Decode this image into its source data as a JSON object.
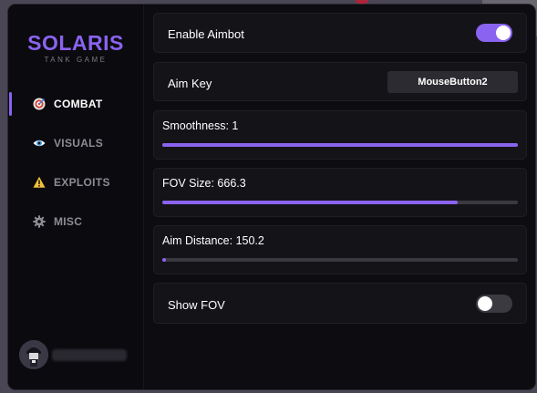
{
  "app": {
    "title": "SOLARIS",
    "subtitle": "TANK GAME",
    "accent": "#8a63f0"
  },
  "sidebar": {
    "items": [
      {
        "label": "COMBAT",
        "icon": "target-icon",
        "active": true
      },
      {
        "label": "VISUALS",
        "icon": "eye-icon",
        "active": false
      },
      {
        "label": "EXPLOITS",
        "icon": "warning-icon",
        "active": false
      },
      {
        "label": "MISC",
        "icon": "gear-icon",
        "active": false
      }
    ]
  },
  "settings": {
    "aimbot": {
      "label": "Enable Aimbot",
      "enabled": true
    },
    "aim_key": {
      "label": "Aim Key",
      "value": "MouseButton2"
    },
    "smoothness": {
      "label": "Smoothness: 1",
      "fraction": 1.0
    },
    "fov_size": {
      "label": "FOV Size: 666.3",
      "fraction": 0.83
    },
    "aim_distance": {
      "label": "Aim Distance: 150.2",
      "fraction": 0.01
    },
    "show_fov": {
      "label": "Show FOV",
      "enabled": false
    }
  }
}
